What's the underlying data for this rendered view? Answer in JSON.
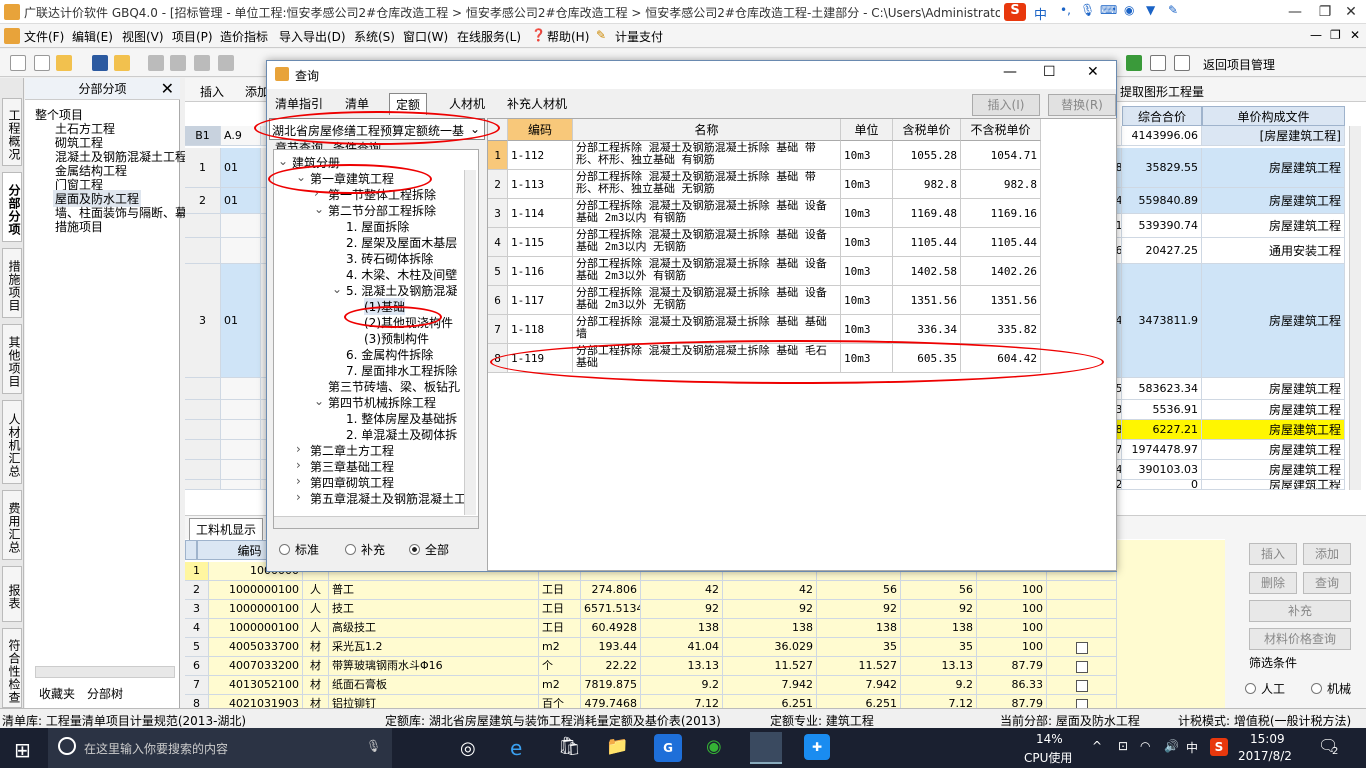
{
  "window": {
    "title": "广联达计价软件 GBQ4.0 - [招标管理 - 单位工程:恒安孝感公司2#仓库改造工程 > 恒安孝感公司2#仓库改造工程 > 恒安孝感公司2#仓库改造工程-土建部分 - C:\\Users\\Administrator.PC",
    "ime_label": "中"
  },
  "menu": [
    "文件(F)",
    "编辑(E)",
    "视图(V)",
    "项目(P)",
    "造价指标",
    "导入导出(D)",
    "系统(S)",
    "窗口(W)",
    "在线服务(L)",
    "帮助(H)",
    "计量支付"
  ],
  "toolbar": {
    "insert": "插入",
    "add": "添加",
    "back_to_project": "返回项目管理",
    "extract_measure": "提取图形工程量"
  },
  "left_tabs": [
    "工程概况",
    "分部分项",
    "措施项目",
    "其他项目",
    "人材机汇总",
    "费用汇总",
    "报表",
    "符合性检查"
  ],
  "tree_panel": {
    "header": "分部分项",
    "items": [
      "整个项目",
      "土石方工程",
      "砌筑工程",
      "混凝土及钢筋混凝土工程",
      "金属结构工程",
      "门窗工程",
      "屋面及防水工程",
      "墙、柱面装饰与隔断、幕墙",
      "措施项目"
    ],
    "bottom_tabs": [
      "收藏夹",
      "分部树"
    ]
  },
  "main_grid": {
    "headers": [
      "综合合价",
      "单价构成文件"
    ],
    "rows": [
      {
        "no": "B1",
        "code": "A.9",
        "partial": "",
        "total": "4143996.06",
        "file": "[房屋建筑工程]"
      },
      {
        "no": "1",
        "code": "01",
        "partial": "0.08",
        "total": "35829.55",
        "file": "房屋建筑工程"
      },
      {
        "no": "2",
        "code": "01",
        "partial": "3.34",
        "total": "559840.89",
        "file": "房屋建筑工程"
      },
      {
        "no": "",
        "code": "",
        "partial": "6.61",
        "total": "539390.74",
        "file": "房屋建筑工程"
      },
      {
        "no": "",
        "code": "",
        "partial": "6.76",
        "total": "20427.25",
        "file": "通用安装工程"
      },
      {
        "no": "3",
        "code": "01",
        "partial": "6.44",
        "total": "3473811.9",
        "file": "房屋建筑工程"
      },
      {
        "no": "",
        "code": "",
        "partial": "3.65",
        "total": "583623.34",
        "file": "房屋建筑工程"
      },
      {
        "no": "",
        "code": "",
        "partial": "4.93",
        "total": "5536.91",
        "file": "房屋建筑工程"
      },
      {
        "no": "",
        "code": "",
        "partial": "9.18",
        "total": "6227.21",
        "file": "房屋建筑工程"
      },
      {
        "no": "",
        "code": "",
        "partial": "1.97",
        "total": "1974478.97",
        "file": "房屋建筑工程"
      },
      {
        "no": "",
        "code": "",
        "partial": "8.04",
        "total": "390103.03",
        "file": "房屋建筑工程"
      },
      {
        "no": "",
        "code": "",
        "partial": "9.32",
        "total": "0",
        "file": "房屋建筑工程"
      }
    ]
  },
  "lower_panel": {
    "tab": "工料机显示",
    "header_code": "编码",
    "rows": [
      {
        "no": "1",
        "code": "1000000",
        "type": "",
        "name": "",
        "unit": "",
        "qty": "",
        "p1": "",
        "p2": "",
        "p3": "",
        "p4": "",
        "p5": "",
        "chk": false
      },
      {
        "no": "2",
        "code": "1000000100",
        "type": "人",
        "name": "普工",
        "unit": "工日",
        "qty": "274.806",
        "p1": "42",
        "p2": "42",
        "p3": "56",
        "p4": "56",
        "p5": "100",
        "chk": false
      },
      {
        "no": "3",
        "code": "1000000100",
        "type": "人",
        "name": "技工",
        "unit": "工日",
        "qty": "6571.5134",
        "p1": "92",
        "p2": "92",
        "p3": "92",
        "p4": "92",
        "p5": "100",
        "chk": false
      },
      {
        "no": "4",
        "code": "1000000100",
        "type": "人",
        "name": "高级技工",
        "unit": "工日",
        "qty": "60.4928",
        "p1": "138",
        "p2": "138",
        "p3": "138",
        "p4": "138",
        "p5": "100",
        "chk": false
      },
      {
        "no": "5",
        "code": "4005033700",
        "type": "材",
        "name": "采光瓦1.2",
        "unit": "m2",
        "qty": "193.44",
        "p1": "41.04",
        "p2": "36.029",
        "p3": "35",
        "p4": "35",
        "p5": "100",
        "chk": true
      },
      {
        "no": "6",
        "code": "4007033200",
        "type": "材",
        "name": "带箅玻璃钢雨水斗Φ16",
        "unit": "个",
        "qty": "22.22",
        "p1": "13.13",
        "p2": "11.527",
        "p3": "11.527",
        "p4": "13.13",
        "p5": "87.79",
        "chk": true
      },
      {
        "no": "7",
        "code": "4013052100",
        "type": "材",
        "name": "纸面石膏板",
        "unit": "m2",
        "qty": "7819.875",
        "p1": "9.2",
        "p2": "7.942",
        "p3": "7.942",
        "p4": "9.2",
        "p5": "86.33",
        "chk": true
      },
      {
        "no": "8",
        "code": "4021031903",
        "type": "材",
        "name": "铝拉铆钉",
        "unit": "百个",
        "qty": "479.7468",
        "p1": "7.12",
        "p2": "6.251",
        "p3": "6.251",
        "p4": "7.12",
        "p5": "87.79",
        "chk": true
      }
    ],
    "buttons": [
      "插入",
      "添加",
      "删除",
      "查询",
      "补充",
      "材料价格查询"
    ],
    "filter_title": "筛选条件",
    "filter_options": [
      "人工",
      "机械"
    ]
  },
  "dialog": {
    "title": "查询",
    "tabs": [
      "清单指引",
      "清单",
      "定额",
      "人材机",
      "补充人材机"
    ],
    "active_tab": "定额",
    "insert_button": "插入(I)",
    "replace_button": "替换(R)",
    "library_select": "湖北省房屋修缮工程预算定额统一基",
    "subtabs": [
      "章节查询",
      "条件查询"
    ],
    "tree": [
      {
        "label": "建筑分册",
        "level": 0,
        "exp": "v"
      },
      {
        "label": "第一章建筑工程",
        "level": 1,
        "exp": "v"
      },
      {
        "label": "第一节整体工程拆除",
        "level": 2,
        "exp": ">"
      },
      {
        "label": "第二节分部工程拆除",
        "level": 2,
        "exp": "v"
      },
      {
        "label": "1. 屋面拆除",
        "level": 3,
        "exp": ""
      },
      {
        "label": "2. 屋架及屋面木基层",
        "level": 3,
        "exp": ""
      },
      {
        "label": "3. 砖石砌体拆除",
        "level": 3,
        "exp": ""
      },
      {
        "label": "4. 木梁、木柱及间壁",
        "level": 3,
        "exp": ""
      },
      {
        "label": "5. 混凝土及钢筋混凝",
        "level": 3,
        "exp": "v"
      },
      {
        "label": "(1)基础",
        "level": 4,
        "exp": ""
      },
      {
        "label": "(2)其他现浇构件",
        "level": 4,
        "exp": ""
      },
      {
        "label": "(3)预制构件",
        "level": 4,
        "exp": ""
      },
      {
        "label": "6. 金属构件拆除",
        "level": 3,
        "exp": ""
      },
      {
        "label": "7. 屋面排水工程拆除",
        "level": 3,
        "exp": ""
      },
      {
        "label": "第三节砖墙、梁、板钻孔",
        "level": 2,
        "exp": ""
      },
      {
        "label": "第四节机械拆除工程",
        "level": 2,
        "exp": "v"
      },
      {
        "label": "1. 整体房屋及基础拆",
        "level": 3,
        "exp": ""
      },
      {
        "label": "2. 单混凝土及砌体拆",
        "level": 3,
        "exp": ""
      },
      {
        "label": "第二章土方工程",
        "level": 1,
        "exp": ">"
      },
      {
        "label": "第三章基础工程",
        "level": 1,
        "exp": ">"
      },
      {
        "label": "第四章砌筑工程",
        "level": 1,
        "exp": ">"
      },
      {
        "label": "第五章混凝土及钢筋混凝土工",
        "level": 1,
        "exp": ">"
      }
    ],
    "radios": [
      "标准",
      "补充",
      "全部"
    ],
    "radio_selected": "全部",
    "grid_headers": [
      "",
      "编码",
      "名称",
      "单位",
      "含税单价",
      "不含税单价"
    ],
    "rows": [
      {
        "no": "1",
        "code": "1-112",
        "name": "分部工程拆除 混凝土及钢筋混凝土拆除 基础 带形、杯形、独立基础 有钢筋",
        "unit": "10m3",
        "taxed": "1055.28",
        "untaxed": "1054.71"
      },
      {
        "no": "2",
        "code": "1-113",
        "name": "分部工程拆除 混凝土及钢筋混凝土拆除 基础 带形、杯形、独立基础 无钢筋",
        "unit": "10m3",
        "taxed": "982.8",
        "untaxed": "982.8"
      },
      {
        "no": "3",
        "code": "1-114",
        "name": "分部工程拆除 混凝土及钢筋混凝土拆除 基础 设备基础 2m3以内 有钢筋",
        "unit": "10m3",
        "taxed": "1169.48",
        "untaxed": "1169.16"
      },
      {
        "no": "4",
        "code": "1-115",
        "name": "分部工程拆除 混凝土及钢筋混凝土拆除 基础 设备基础 2m3以内 无钢筋",
        "unit": "10m3",
        "taxed": "1105.44",
        "untaxed": "1105.44"
      },
      {
        "no": "5",
        "code": "1-116",
        "name": "分部工程拆除 混凝土及钢筋混凝土拆除 基础 设备基础 2m3以外 有钢筋",
        "unit": "10m3",
        "taxed": "1402.58",
        "untaxed": "1402.26"
      },
      {
        "no": "6",
        "code": "1-117",
        "name": "分部工程拆除 混凝土及钢筋混凝土拆除 基础 设备基础 2m3以外 无钢筋",
        "unit": "10m3",
        "taxed": "1351.56",
        "untaxed": "1351.56"
      },
      {
        "no": "7",
        "code": "1-118",
        "name": "分部工程拆除 混凝土及钢筋混凝土拆除 基础 基础墙",
        "unit": "10m3",
        "taxed": "336.34",
        "untaxed": "335.82"
      },
      {
        "no": "8",
        "code": "1-119",
        "name": "分部工程拆除 混凝土及钢筋混凝土拆除 基础 毛石基础",
        "unit": "10m3",
        "taxed": "605.35",
        "untaxed": "604.42"
      }
    ]
  },
  "status": {
    "list_lib": "清单库: 工程量清单项目计量规范(2013-湖北)",
    "quota_lib": "定额库: 湖北省房屋建筑与装饰工程消耗量定额及基价表(2013)",
    "quota_major": "定额专业: 建筑工程",
    "current_part": "当前分部: 屋面及防水工程",
    "tax_mode": "计税模式: 增值税(一般计税方法)"
  },
  "taskbar": {
    "search_placeholder": "在这里输入你要搜索的内容",
    "cpu_percent": "14%",
    "cpu_label": "CPU使用",
    "lang": "中",
    "time": "15:09",
    "date": "2017/8/2",
    "notif_count": "2"
  }
}
